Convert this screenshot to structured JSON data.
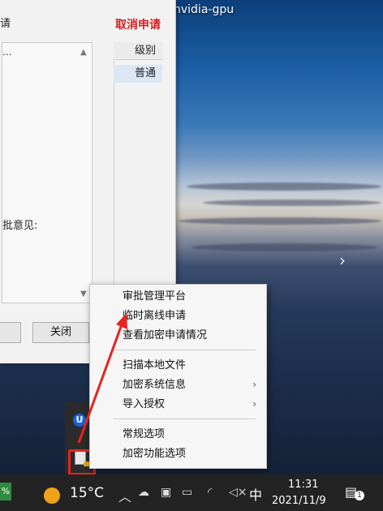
{
  "desktop": {
    "label": "nvidia-gpu"
  },
  "app_window": {
    "title_fragment": "请",
    "cancel_link": "取消申请",
    "list_ellipsis": "...",
    "opinion_label": "批意见:",
    "table": {
      "header": "级别",
      "cell": "普通"
    },
    "buttons": {
      "left_fragment": "",
      "close": "关闭"
    }
  },
  "context_menu": {
    "items": [
      {
        "label": "审批管理平台",
        "has_submenu": false
      },
      {
        "label": "临时离线申请",
        "has_submenu": false
      },
      {
        "label": "查看加密申请情况",
        "has_submenu": false
      },
      {
        "label": "扫描本地文件",
        "has_submenu": false
      },
      {
        "label": "加密系统信息",
        "has_submenu": true
      },
      {
        "label": "导入授权",
        "has_submenu": true
      },
      {
        "label": "常规选项",
        "has_submenu": false
      },
      {
        "label": "加密功能选项",
        "has_submenu": false
      }
    ],
    "submenu_arrow": "›"
  },
  "tray_flyout": {
    "icons": [
      "u-app-icon",
      "encryption-doc-icon"
    ]
  },
  "annotation": {
    "color": "#e8231f"
  },
  "taskbar": {
    "battery_fragment": "%",
    "temperature": "15°C",
    "tray_chevron": "︿",
    "ime": "中",
    "time": "11:31",
    "date": "2021/11/9",
    "notification_count": "1"
  },
  "colors": {
    "accent_red": "#d21f1f",
    "taskbar": "#232323",
    "menu_bg": "#f6f6f6"
  }
}
